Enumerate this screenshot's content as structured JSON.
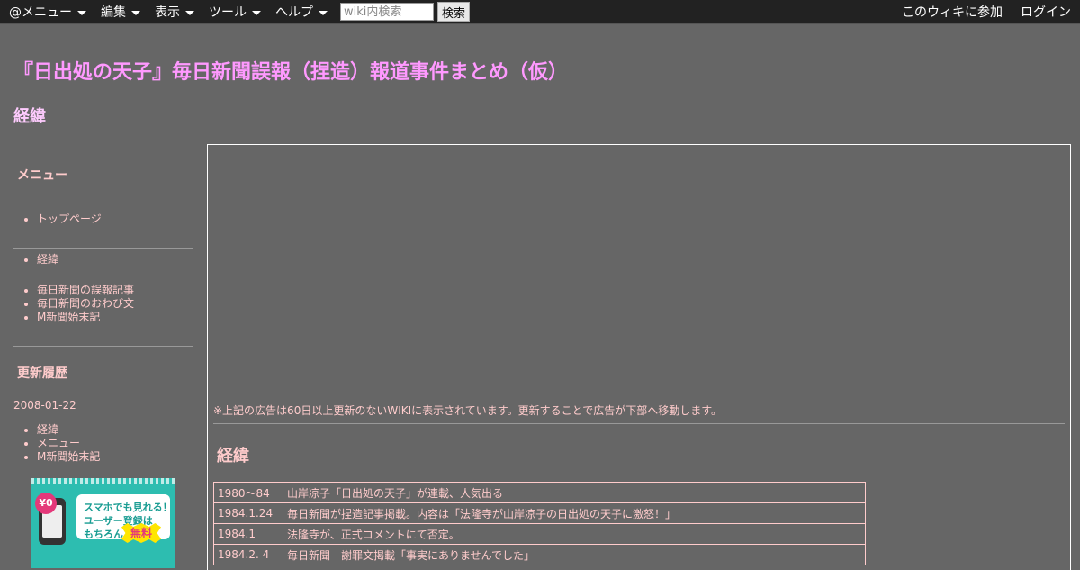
{
  "topbar": {
    "menus": [
      "@メニュー",
      "編集",
      "表示",
      "ツール",
      "ヘルプ"
    ],
    "search_placeholder": "wiki内検索",
    "search_button": "検索",
    "join_label": "このウィキに参加",
    "login_label": "ログイン"
  },
  "site_title": "『日出処の天子』毎日新聞誤報（捏造）報道事件まとめ（仮）",
  "page_heading": "経緯",
  "sidebar": {
    "menu_heading": "メニュー",
    "top_page": "トップページ",
    "nav_b": [
      "経緯"
    ],
    "nav_c": [
      "毎日新聞の誤報記事",
      "毎日新聞のおわび文",
      "M新聞始末記"
    ],
    "history_heading": "更新履歴",
    "history_date": "2008-01-22",
    "history_items": [
      "経緯",
      "メニュー",
      "M新聞始末記"
    ],
    "promo": {
      "badge": "¥0",
      "line1": "スマホでも見れる！",
      "line2": "ユーザー登録は",
      "line3": "もちろん",
      "free": "無料"
    }
  },
  "main": {
    "ad_note": "※上記の広告は60日以上更新のないWIKIに表示されています。更新することで広告が下部へ移動します。",
    "heading": "経緯",
    "timeline": [
      {
        "date": "1980〜84",
        "event": "山岸凉子「日出処の天子」が連載、人気出る"
      },
      {
        "date": "1984.1.24",
        "event": "毎日新聞が捏造記事掲載。内容は「法隆寺が山岸凉子の日出処の天子に激怒！」"
      },
      {
        "date": "1984.1",
        "event": "法隆寺が、正式コメントにて否定。"
      },
      {
        "date": "1984.2. 4",
        "event": "毎日新聞　謝罪文掲載「事実にありませんでした」"
      }
    ]
  },
  "colors": {
    "background": "#666666",
    "topbar": "#222222",
    "title": "#ff99ff",
    "text": "#ffcccc"
  }
}
